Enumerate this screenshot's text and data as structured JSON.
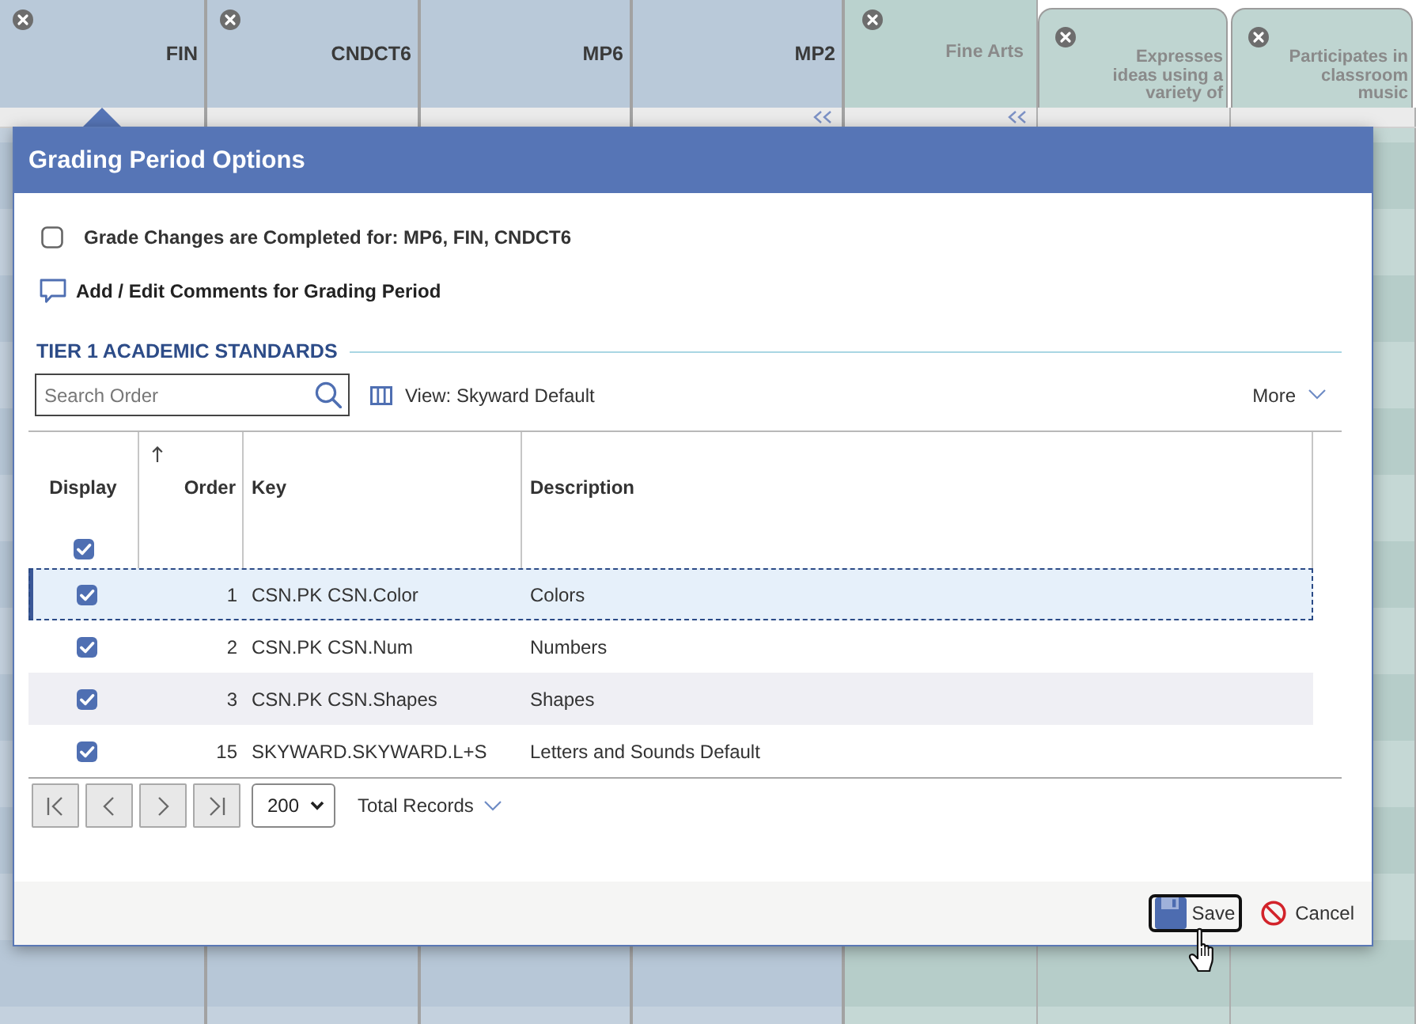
{
  "grade_columns": [
    {
      "label": "FIN",
      "kind": "period",
      "removable": true,
      "collapsible": false,
      "selected": true
    },
    {
      "label": "CNDCT6",
      "kind": "period",
      "removable": true,
      "collapsible": false,
      "selected": false
    },
    {
      "label": "MP6",
      "kind": "period",
      "removable": false,
      "collapsible": false,
      "selected": false
    },
    {
      "label": "MP2",
      "kind": "period",
      "removable": false,
      "collapsible": true,
      "selected": false
    },
    {
      "label": "Fine Arts",
      "kind": "subject",
      "removable": true,
      "collapsible": true,
      "selected": false
    },
    {
      "label": "Expresses ideas using a variety of",
      "kind": "standard",
      "removable": true,
      "collapsible": false,
      "selected": false
    },
    {
      "label": "Participates in classroom music",
      "kind": "standard",
      "removable": true,
      "collapsible": false,
      "selected": false
    }
  ],
  "dialog": {
    "title": "Grading Period Options",
    "completed": {
      "label": "Grade Changes are Completed for: MP6, FIN, CNDCT6",
      "checked": false
    },
    "comments_link": "Add / Edit Comments for Grading Period",
    "section_title": "TIER 1 ACADEMIC STANDARDS",
    "search": {
      "placeholder": "Search Order"
    },
    "view_label": "View: Skyward Default",
    "more_label": "More",
    "table": {
      "columns": [
        {
          "label": "Display",
          "kind": "check",
          "sorted": false
        },
        {
          "label": "Order",
          "kind": "number",
          "sorted": true
        },
        {
          "label": "Key",
          "kind": "text",
          "sorted": false
        },
        {
          "label": "Description",
          "kind": "text",
          "sorted": false
        }
      ],
      "select_all": {
        "checked": true
      },
      "rows": [
        {
          "selected": true,
          "cells": [
            {
              "checked": true
            },
            "1",
            "CSN.PK CSN.Color",
            "Colors"
          ]
        },
        {
          "selected": false,
          "cells": [
            {
              "checked": true
            },
            "2",
            "CSN.PK CSN.Num",
            "Numbers"
          ]
        },
        {
          "selected": false,
          "cells": [
            {
              "checked": true
            },
            "3",
            "CSN.PK CSN.Shapes",
            "Shapes"
          ]
        },
        {
          "selected": false,
          "cells": [
            {
              "checked": true
            },
            "15",
            "SKYWARD.SKYWARD.L+S",
            "Letters and Sounds Default"
          ]
        }
      ]
    },
    "pager": {
      "page_size": "200",
      "total_label": "Total Records"
    },
    "buttons": [
      {
        "label": "Save",
        "kind": "save",
        "focused": true
      },
      {
        "label": "Cancel",
        "kind": "cancel",
        "focused": false
      }
    ]
  }
}
